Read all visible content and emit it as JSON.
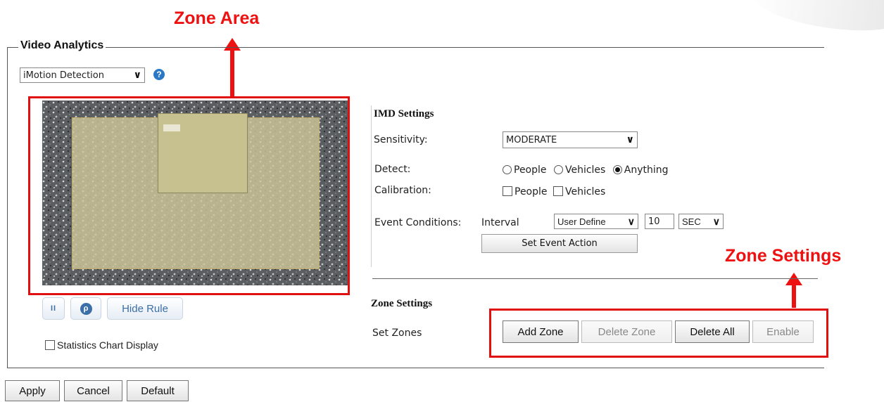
{
  "annotations": {
    "zone_area": "Zone Area",
    "zone_settings": "Zone Settings"
  },
  "panel": {
    "legend": "Video Analytics"
  },
  "mode_select": {
    "value": "iMotion Detection",
    "help_icon": "question-circle-icon"
  },
  "video_controls": {
    "pause_icon": "pause-icon",
    "search_icon": "search-circle-icon",
    "hide_rule": "Hide Rule",
    "pause_glyph": "II",
    "search_glyph": "ρ"
  },
  "statistics": {
    "label": "Statistics Chart Display"
  },
  "imd": {
    "title": "IMD Settings",
    "sensitivity_label": "Sensitivity:",
    "sensitivity_value": "MODERATE",
    "detect_label": "Detect:",
    "detect_options": [
      "People",
      "Vehicles",
      "Anything"
    ],
    "detect_selected": "Anything",
    "calibration_label": "Calibration:",
    "calibration_options": [
      "People",
      "Vehicles"
    ],
    "event_label": "Event Conditions:",
    "interval_label": "Interval",
    "interval_mode": "User Define",
    "interval_value": "10",
    "interval_unit": "SEC",
    "set_event_action": "Set Event Action"
  },
  "zones": {
    "title": "Zone Settings",
    "set_zones_label": "Set Zones",
    "add": "Add Zone",
    "delete": "Delete Zone",
    "delete_all": "Delete All",
    "enable": "Enable"
  },
  "footer": {
    "apply": "Apply",
    "cancel": "Cancel",
    "default": "Default"
  },
  "colors": {
    "annotation": "#ee1111",
    "link_blue": "#3a6fa8",
    "zone_fill": "#cfc89a"
  }
}
